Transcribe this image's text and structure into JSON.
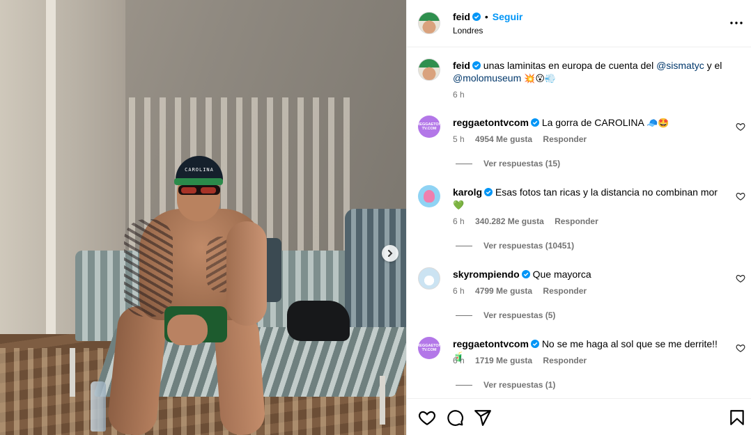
{
  "post": {
    "author": "feid",
    "follow_label": "Seguir",
    "location": "Londres",
    "dot": "•",
    "cap_text": "CAROLINA"
  },
  "caption": {
    "author": "feid",
    "text_before": "unas laminitas en europa de cuenta del ",
    "mention1": "@sismatyc",
    "text_mid": " y el",
    "mention2": "@molomuseum",
    "emojis": "💥😮💨",
    "time": "6 h"
  },
  "comments": [
    {
      "avatar_text": "REGGAETON TV.COM",
      "user": "reggaetontvcom",
      "text": "La gorra de CAROLINA",
      "emojis": "🧢🤩",
      "time": "5 h",
      "likes": "4954 Me gusta",
      "reply_label": "Responder",
      "replies": "Ver respuestas (15)"
    },
    {
      "avatar_text": "",
      "user": "karolg",
      "text": "Esas fotos tan ricas y la distancia no combinan mor",
      "emojis": "💚",
      "time": "6 h",
      "likes": "340.282 Me gusta",
      "reply_label": "Responder",
      "replies": "Ver respuestas (10451)"
    },
    {
      "avatar_text": "",
      "user": "skyrompiendo",
      "text": "Que mayorca",
      "emojis": "",
      "time": "6 h",
      "likes": "4799 Me gusta",
      "reply_label": "Responder",
      "replies": "Ver respuestas (5)"
    },
    {
      "avatar_text": "REGGAETON TV.COM",
      "user": "reggaetontvcom",
      "text": "No se me haga al sol que se me derrite!!",
      "emojis": "🧃",
      "time": "6 h",
      "likes": "1719 Me gusta",
      "reply_label": "Responder",
      "replies": "Ver respuestas (1)"
    }
  ],
  "colors": {
    "accent": "#0095f6",
    "mention": "#00376b",
    "meta": "#737373",
    "verified": "#0095f6"
  },
  "icons": [
    "like-icon",
    "comment-icon",
    "share-icon",
    "save-icon",
    "more-icon",
    "next-arrow-icon",
    "verified-icon"
  ]
}
